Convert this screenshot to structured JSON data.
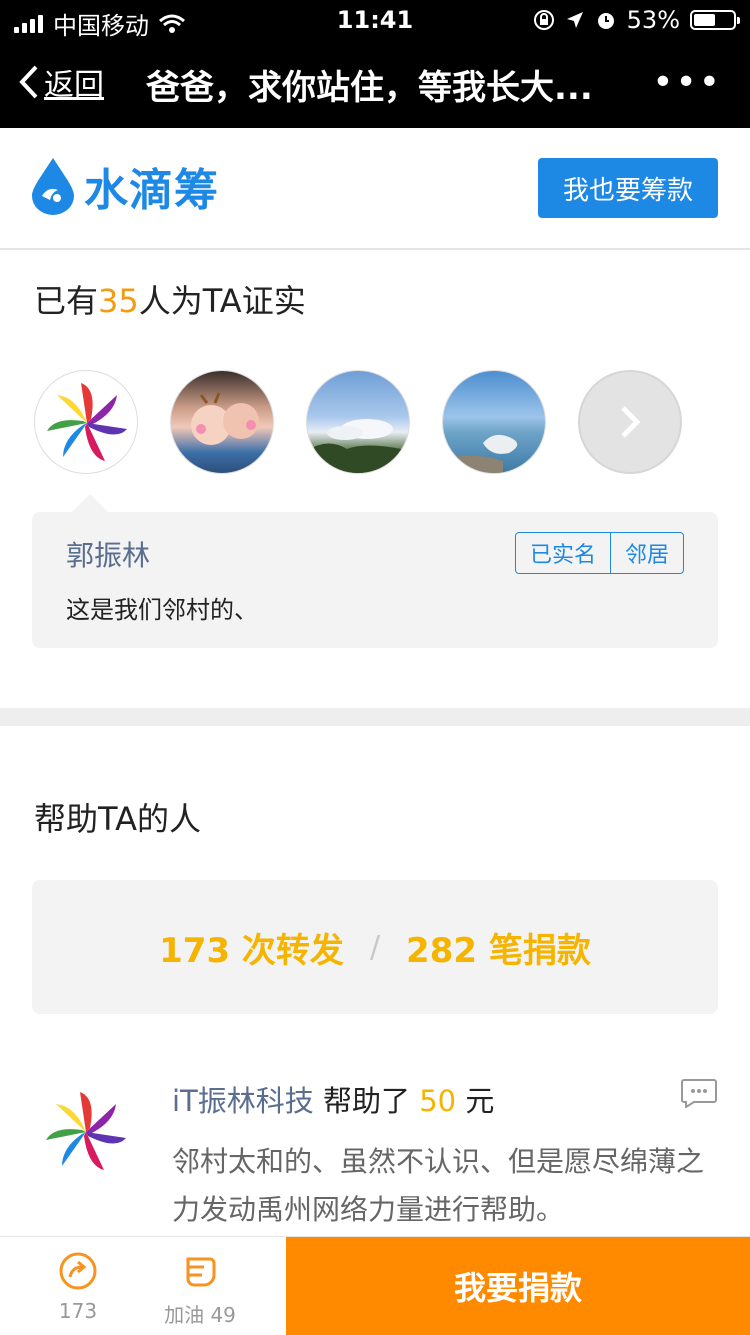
{
  "status_bar": {
    "carrier": "中国移动",
    "time": "11:41",
    "battery": "53%",
    "battery_level": 0.53
  },
  "nav": {
    "back": "返回",
    "title": "爸爸，求你站住，等我长大...",
    "more": "•••"
  },
  "brand": {
    "name": "水滴筹",
    "raise_button": "我也要筹款"
  },
  "verify": {
    "prefix": "已有",
    "count": "35",
    "suffix": "人为TA证实"
  },
  "comment": {
    "name": "郭振林",
    "tags": [
      "已实名",
      "邻居"
    ],
    "text": "这是我们邻村的、"
  },
  "help": {
    "title": "帮助TA的人",
    "shares": "173 次转发",
    "separator": "/",
    "donations": "282 笔捐款"
  },
  "donor": {
    "name": "iT振林科技",
    "action": "帮助了",
    "amount": "50",
    "unit": "元",
    "message": "邻村太和的、虽然不认识、但是愿尽绵薄之力发动禹州网络力量进行帮助。"
  },
  "bottom": {
    "share_count": "173",
    "cheer_label": "加油 49",
    "donate_label": "我要捐款"
  },
  "colors": {
    "brand_blue": "#1e88e5",
    "orange": "#ff8a00",
    "gold": "#f5b400",
    "count_orange": "#f39c12"
  }
}
